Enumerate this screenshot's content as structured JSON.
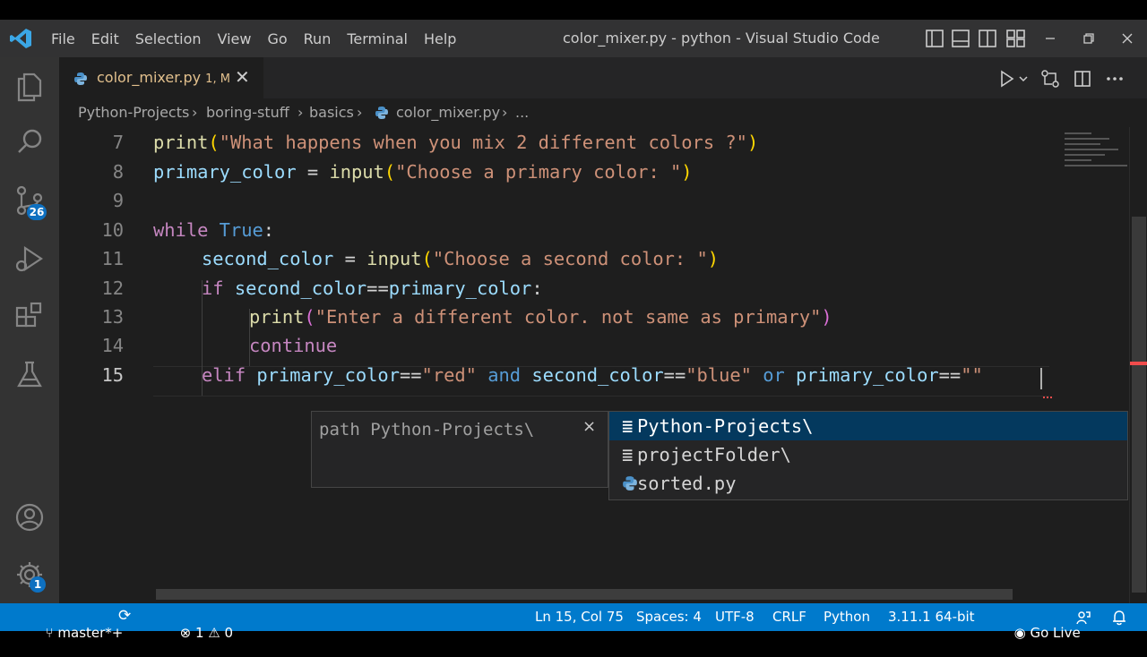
{
  "titlebar": {
    "menu": [
      "File",
      "Edit",
      "Selection",
      "View",
      "Go",
      "Run",
      "Terminal",
      "Help"
    ],
    "window_title": "color_mixer.py - python - Visual Studio Code"
  },
  "activity_bar": {
    "items": [
      "explorer-icon",
      "search-icon",
      "source-control-icon",
      "run-debug-icon",
      "extensions-icon",
      "testing-icon"
    ],
    "source_control_badge": "26",
    "settings_badge": "1"
  },
  "tab": {
    "filename": "color_mixer.py",
    "status": "1, M"
  },
  "breadcrumbs": [
    "Python-Projects",
    "boring-stuff",
    "basics",
    "color_mixer.py",
    "..."
  ],
  "editor": {
    "lines": [
      {
        "n": "7"
      },
      {
        "n": "8"
      },
      {
        "n": "9"
      },
      {
        "n": "10"
      },
      {
        "n": "11"
      },
      {
        "n": "12"
      },
      {
        "n": "13"
      },
      {
        "n": "14"
      },
      {
        "n": "15"
      }
    ],
    "code": {
      "l7": {
        "fn": "print",
        "str": "\"What happens when you mix 2 different colors ?\""
      },
      "l8": {
        "var": "primary_color",
        "op": " = ",
        "fn": "input",
        "str": "\"Choose a primary color: \""
      },
      "l10": {
        "kw": "while",
        "val": "True",
        "colon": ":"
      },
      "l11": {
        "var": "second_color",
        "op": " = ",
        "fn": "input",
        "str": "\"Choose a second color: \""
      },
      "l12": {
        "kw": "if",
        "cond_a": "second_color",
        "op": "==",
        "cond_b": "primary_color",
        "colon": ":"
      },
      "l13": {
        "fn": "print",
        "str": "\"Enter a different color. not same as primary\""
      },
      "l14": {
        "kw": "continue"
      },
      "l15": {
        "kw": "elif",
        "a": "primary_color",
        "eq1": "==",
        "s1": "\"red\"",
        "and": "and",
        "b": "second_color",
        "eq2": "==",
        "s2": "\"blue\"",
        "or": "or",
        "c": "primary_color",
        "eq3": "==",
        "s3": "\"\""
      }
    }
  },
  "parameter_hint": {
    "text": "path Python-Projects\\",
    "close": "×"
  },
  "suggestions": [
    {
      "label": "Python-Projects\\",
      "kind": "folder-icon",
      "selected": true
    },
    {
      "label": "projectFolder\\",
      "kind": "folder-icon",
      "selected": false
    },
    {
      "label": "sorted.py",
      "kind": "python-file-icon",
      "selected": false
    }
  ],
  "statusbar": {
    "branch": "master*+",
    "errors": "1",
    "warnings": "0",
    "position": "Ln 15, Col 75",
    "spaces": "Spaces: 4",
    "encoding": "UTF-8",
    "eol": "CRLF",
    "language": "Python",
    "interpreter": "3.11.1 64-bit",
    "go_live": "Go Live"
  },
  "colors": {
    "accent": "#007acc",
    "badge": "#0e70c0",
    "selection": "#04395e"
  }
}
